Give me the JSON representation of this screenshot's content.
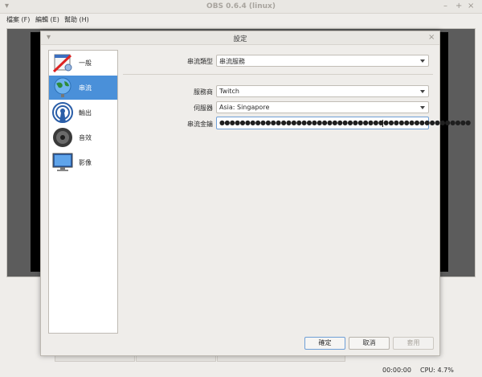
{
  "main_window": {
    "title": "OBS 0.6.4 (linux)",
    "menu": [
      {
        "label": "檔案 (F)"
      },
      {
        "label": "編輯 (E)"
      },
      {
        "label": "幫助 (H)"
      }
    ],
    "status": {
      "time": "00:00:00",
      "cpu": "CPU: 4.7%"
    }
  },
  "dialog": {
    "title": "設定",
    "nav": [
      {
        "label": "一般",
        "icon": "general-settings-icon"
      },
      {
        "label": "串流",
        "icon": "globe-stream-icon"
      },
      {
        "label": "輸出",
        "icon": "broadcast-output-icon"
      },
      {
        "label": "音效",
        "icon": "speaker-audio-icon"
      },
      {
        "label": "影像",
        "icon": "monitor-video-icon"
      }
    ],
    "active_nav": "串流",
    "stream": {
      "type_label": "串流類型",
      "type_value": "串流服務",
      "service_label": "服務商",
      "service_value": "Twitch",
      "server_label": "伺服器",
      "server_value": "Asia: Singapore",
      "key_label": "串流金鑰",
      "key_value": "●●●●●●●●●●●●●●●●●●●●●●●●●●●●●●●●●●●●●●●●●●●●●●●●●"
    },
    "buttons": {
      "ok": "確定",
      "cancel": "取消",
      "apply": "套用"
    }
  },
  "colors": {
    "accent": "#4a90d9",
    "focus": "#6f9fd6"
  }
}
